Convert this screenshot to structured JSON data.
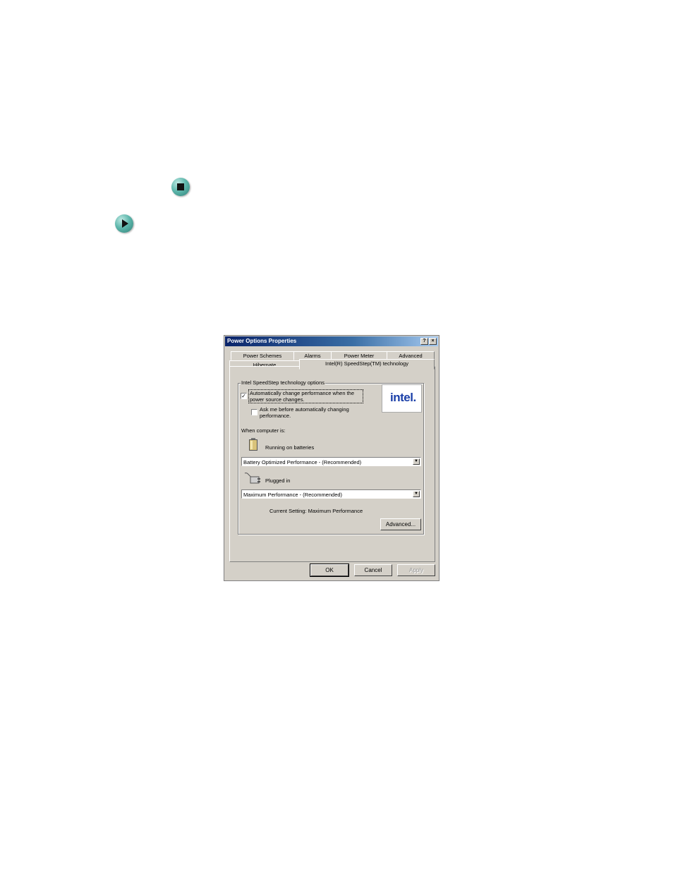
{
  "dialog": {
    "title": "Power Options Properties",
    "help_glyph": "?",
    "close_glyph": "×",
    "tabs_row1": [
      "Power Schemes",
      "Alarms",
      "Power Meter",
      "Advanced"
    ],
    "tabs_row2": [
      "Hibernate",
      "Intel(R) SpeedStep(TM) technology"
    ],
    "active_tab": "Intel(R) SpeedStep(TM) technology",
    "groupbox_label": "Intel SpeedStep technology options",
    "auto_change": {
      "label_line1": "Automatically change performance when the",
      "label_line2": "power source changes.",
      "checked": true,
      "check_glyph": "✓"
    },
    "ask_before": {
      "label_line1": "Ask me before automatically changing",
      "label_line2": "performance.",
      "checked": false
    },
    "when_label": "When computer is:",
    "batteries_label": "Running on batteries",
    "batteries_value": "Battery Optimized Performance - (Recommended)",
    "plugged_label": "Plugged in",
    "plugged_value": "Maximum Performance - (Recommended)",
    "current_setting": "Current Setting:  Maximum Performance",
    "advanced_button": "Advanced...",
    "ok_button": "OK",
    "cancel_button": "Cancel",
    "apply_button": "Apply",
    "logo_text": "intel.",
    "dropdown_arrow": "▼"
  }
}
